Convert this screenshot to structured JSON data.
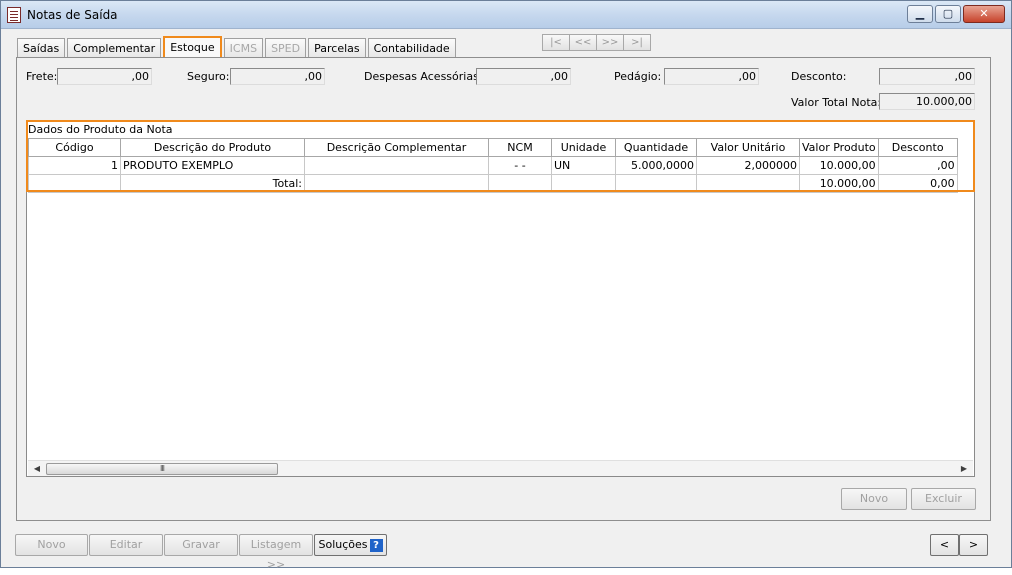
{
  "window": {
    "title": "Notas de Saída"
  },
  "tabs": [
    {
      "label": "Saídas",
      "state": "normal"
    },
    {
      "label": "Complementar",
      "state": "normal"
    },
    {
      "label": "Estoque",
      "state": "active"
    },
    {
      "label": "ICMS",
      "state": "disabled"
    },
    {
      "label": "SPED",
      "state": "disabled"
    },
    {
      "label": "Parcelas",
      "state": "normal"
    },
    {
      "label": "Contabilidade",
      "state": "normal"
    }
  ],
  "record_nav": {
    "first": "|<",
    "prev": "<<",
    "next": ">>",
    "last": ">|"
  },
  "fields": {
    "frete": {
      "label": "Frete:",
      "value": ",00"
    },
    "seguro": {
      "label": "Seguro:",
      "value": ",00"
    },
    "despesas": {
      "label": "Despesas Acessórias:",
      "value": ",00"
    },
    "pedagio": {
      "label": "Pedágio:",
      "value": ",00"
    },
    "desconto": {
      "label": "Desconto:",
      "value": ",00"
    },
    "valor_total": {
      "label": "Valor Total Nota:",
      "value": "10.000,00"
    }
  },
  "grid": {
    "caption": "Dados do Produto da Nota",
    "columns": [
      "Código",
      "Descrição do Produto",
      "Descrição Complementar",
      "NCM",
      "Unidade",
      "Quantidade",
      "Valor Unitário",
      "Valor Produto",
      "Desconto"
    ],
    "row": {
      "codigo": "1",
      "descricao": "PRODUTO EXEMPLO",
      "complementar": "",
      "ncm": "- -",
      "unidade": "UN",
      "quantidade": "5.000,0000",
      "valor_unitario": "2,000000",
      "valor_produto": "10.000,00",
      "desconto": ",00"
    },
    "total": {
      "label": "Total:",
      "valor_produto": "10.000,00",
      "desconto": "0,00"
    },
    "scroll_thumb_grip": "III"
  },
  "panel_buttons": {
    "novo": "Novo",
    "excluir": "Excluir"
  },
  "bottom_buttons": {
    "novo": "Novo",
    "editar": "Editar",
    "gravar": "Gravar",
    "listagem": "Listagem >>",
    "solucoes": "Soluções",
    "help": "?",
    "prev": "<",
    "next": ">"
  },
  "colors": {
    "highlight": "#f08a1c",
    "help_badge": "#1f63c9"
  }
}
